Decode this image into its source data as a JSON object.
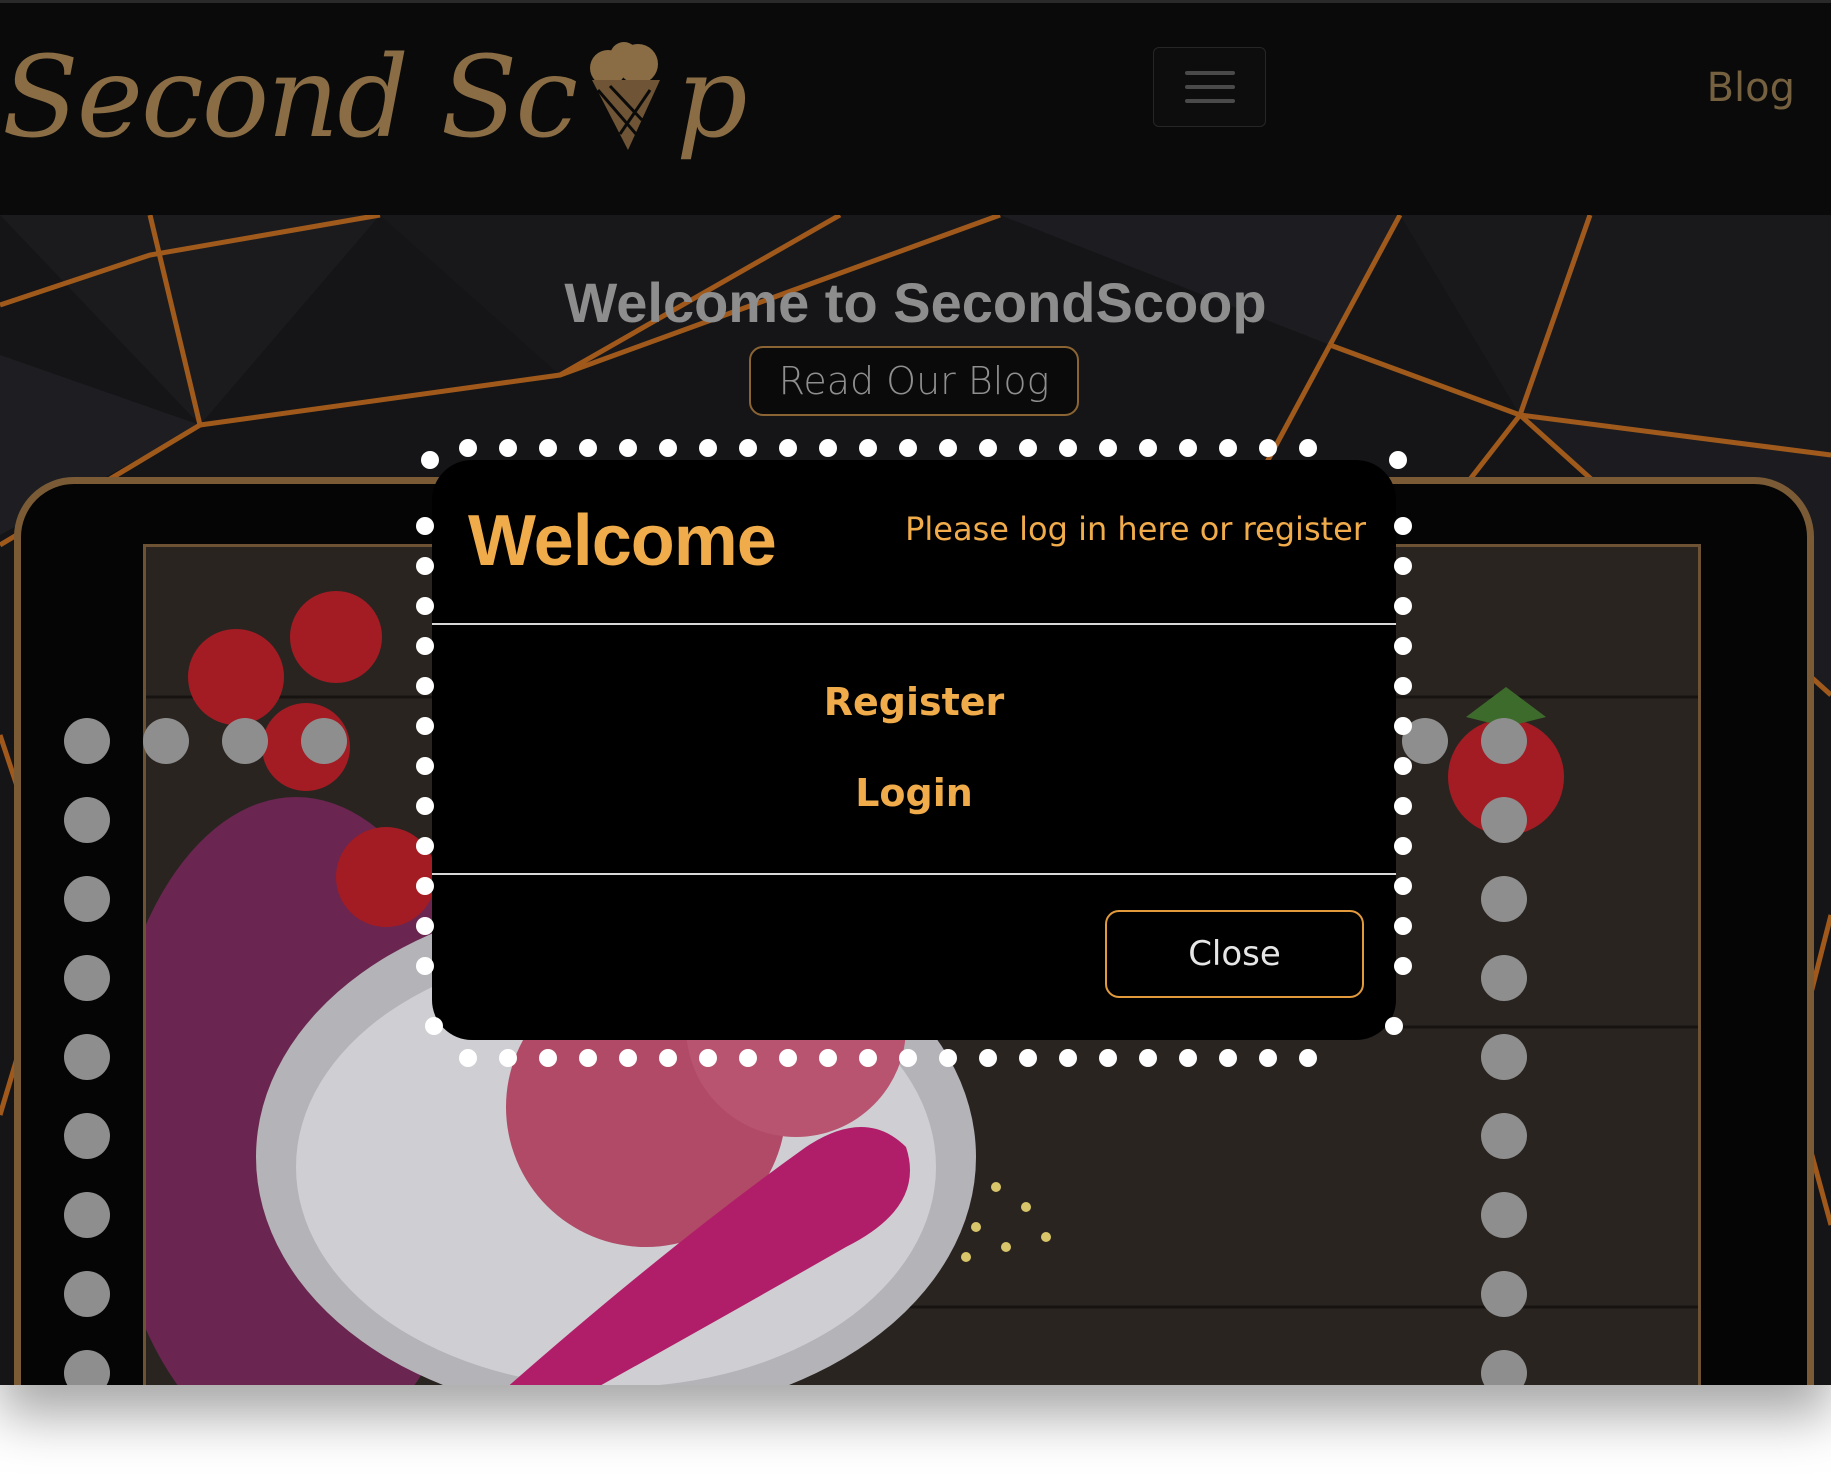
{
  "navbar": {
    "brand_left": "Second Sc",
    "brand_right": "p",
    "toggler_icon": "hamburger-icon",
    "blog_link": "Blog"
  },
  "hero": {
    "title": "Welcome to SecondScoop",
    "blog_button": "Read Our Blog"
  },
  "modal": {
    "title": "Welcome",
    "subtitle": "Please log in here or register",
    "register_link": "Register",
    "login_link": "Login",
    "close_button": "Close"
  },
  "colors": {
    "accent": "#f0ab4a",
    "brand": "#8a6d45",
    "frame": "#7a5b36",
    "bulb": "#8e8e8e"
  }
}
